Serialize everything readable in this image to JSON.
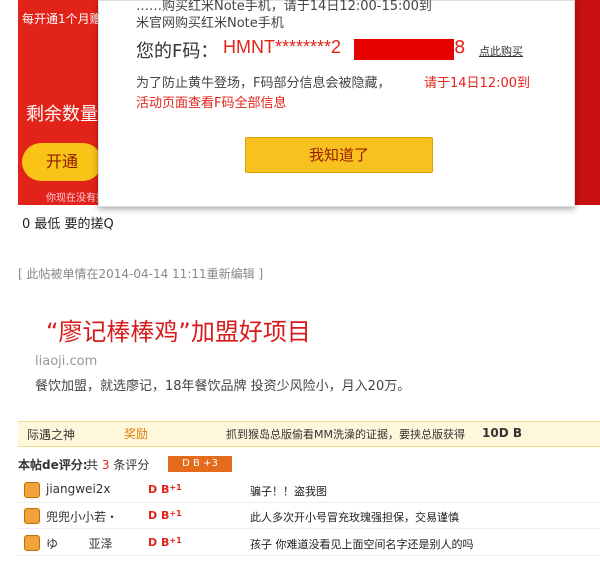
{
  "background": {
    "top_left_text": "每开通1个月赠",
    "remaining_label": "剩余数量：",
    "open_button": "开通",
    "note": "你现在没有抢"
  },
  "popup": {
    "line1": "……购买红米Note手机，请于14日12:00-15:00到",
    "line2": "米官网购买红米Note手机",
    "fcode_label": "您的F码：",
    "fcode_value": "HMNT********2",
    "fcode_last": "8",
    "buy_link": "点此购买",
    "notice_a": "为了防止黄牛登场，F码部分信息会被隐藏，",
    "notice_b": "请于14日12:00到",
    "notice_c": "活动页面查看F码全部信息",
    "ok_button": "我知道了"
  },
  "post": {
    "text": "0 最低  要的搓Q",
    "edit_note": "[ 此帖被单情在2014-04-14 11:11重新编辑 ]"
  },
  "ad": {
    "title": "“廖记棒棒鸡”加盟好项目",
    "url": "liaoji.com",
    "desc": "餐饮加盟，就选廖记，18年餐饮品牌 投资少风险小，月入20万。"
  },
  "reward": {
    "user": "际遇之神",
    "label": "奖励",
    "message": "抓到猴岛总版偷看MM洗澡的证据，要挟总版获得",
    "value": "10D B"
  },
  "ratings": {
    "heading": "本帖de评分:",
    "count_prefix": "共",
    "count": "3",
    "count_suffix": "条评分",
    "badge": "D B  +3",
    "rows": [
      {
        "user": "jiangwei2x",
        "score": "D B",
        "sup": "+1",
        "comment": "骗子！！盗我图"
      },
      {
        "user": "兜兜小小若・",
        "score": "D B",
        "sup": "+1",
        "comment": "此人多次开小号冒充玫瑰强担保，交易谨慎"
      },
      {
        "user": "ゆ        亚泽",
        "score": "D B",
        "sup": "+1",
        "comment": "孩子 你难道没看见上面空间名字还是别人的吗"
      }
    ]
  }
}
